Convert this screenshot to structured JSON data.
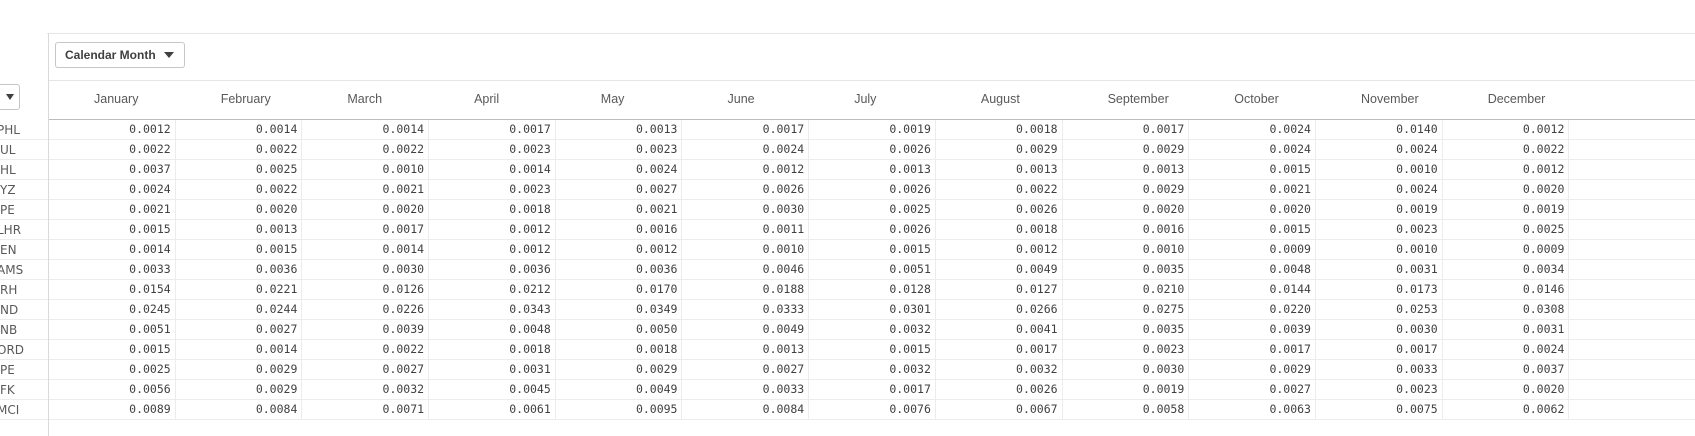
{
  "dimension_button": {
    "label": "Calendar Month"
  },
  "months": [
    "January",
    "February",
    "March",
    "April",
    "May",
    "June",
    "July",
    "August",
    "September",
    "October",
    "November",
    "December"
  ],
  "row_labels": [
    "PHL",
    "UL",
    "HL",
    "YZ",
    "PE",
    "LHR",
    "EN",
    "AMS",
    "RH",
    "ND",
    "NB",
    "ORD",
    "PE",
    "FK",
    "MCI"
  ],
  "rows": [
    [
      "0.0012",
      "0.0014",
      "0.0014",
      "0.0017",
      "0.0013",
      "0.0017",
      "0.0019",
      "0.0018",
      "0.0017",
      "0.0024",
      "0.0140",
      "0.0012"
    ],
    [
      "0.0022",
      "0.0022",
      "0.0022",
      "0.0023",
      "0.0023",
      "0.0024",
      "0.0026",
      "0.0029",
      "0.0029",
      "0.0024",
      "0.0024",
      "0.0022"
    ],
    [
      "0.0037",
      "0.0025",
      "0.0010",
      "0.0014",
      "0.0024",
      "0.0012",
      "0.0013",
      "0.0013",
      "0.0013",
      "0.0015",
      "0.0010",
      "0.0012"
    ],
    [
      "0.0024",
      "0.0022",
      "0.0021",
      "0.0023",
      "0.0027",
      "0.0026",
      "0.0026",
      "0.0022",
      "0.0029",
      "0.0021",
      "0.0024",
      "0.0020"
    ],
    [
      "0.0021",
      "0.0020",
      "0.0020",
      "0.0018",
      "0.0021",
      "0.0030",
      "0.0025",
      "0.0026",
      "0.0020",
      "0.0020",
      "0.0019",
      "0.0019"
    ],
    [
      "0.0015",
      "0.0013",
      "0.0017",
      "0.0012",
      "0.0016",
      "0.0011",
      "0.0026",
      "0.0018",
      "0.0016",
      "0.0015",
      "0.0023",
      "0.0025"
    ],
    [
      "0.0014",
      "0.0015",
      "0.0014",
      "0.0012",
      "0.0012",
      "0.0010",
      "0.0015",
      "0.0012",
      "0.0010",
      "0.0009",
      "0.0010",
      "0.0009"
    ],
    [
      "0.0033",
      "0.0036",
      "0.0030",
      "0.0036",
      "0.0036",
      "0.0046",
      "0.0051",
      "0.0049",
      "0.0035",
      "0.0048",
      "0.0031",
      "0.0034"
    ],
    [
      "0.0154",
      "0.0221",
      "0.0126",
      "0.0212",
      "0.0170",
      "0.0188",
      "0.0128",
      "0.0127",
      "0.0210",
      "0.0144",
      "0.0173",
      "0.0146"
    ],
    [
      "0.0245",
      "0.0244",
      "0.0226",
      "0.0343",
      "0.0349",
      "0.0333",
      "0.0301",
      "0.0266",
      "0.0275",
      "0.0220",
      "0.0253",
      "0.0308"
    ],
    [
      "0.0051",
      "0.0027",
      "0.0039",
      "0.0048",
      "0.0050",
      "0.0049",
      "0.0032",
      "0.0041",
      "0.0035",
      "0.0039",
      "0.0030",
      "0.0031"
    ],
    [
      "0.0015",
      "0.0014",
      "0.0022",
      "0.0018",
      "0.0018",
      "0.0013",
      "0.0015",
      "0.0017",
      "0.0023",
      "0.0017",
      "0.0017",
      "0.0024"
    ],
    [
      "0.0025",
      "0.0029",
      "0.0027",
      "0.0031",
      "0.0029",
      "0.0027",
      "0.0032",
      "0.0032",
      "0.0030",
      "0.0029",
      "0.0033",
      "0.0037"
    ],
    [
      "0.0056",
      "0.0029",
      "0.0032",
      "0.0045",
      "0.0049",
      "0.0033",
      "0.0017",
      "0.0026",
      "0.0019",
      "0.0027",
      "0.0023",
      "0.0020"
    ],
    [
      "0.0089",
      "0.0084",
      "0.0071",
      "0.0061",
      "0.0095",
      "0.0084",
      "0.0076",
      "0.0067",
      "0.0058",
      "0.0063",
      "0.0075",
      "0.0062"
    ]
  ]
}
